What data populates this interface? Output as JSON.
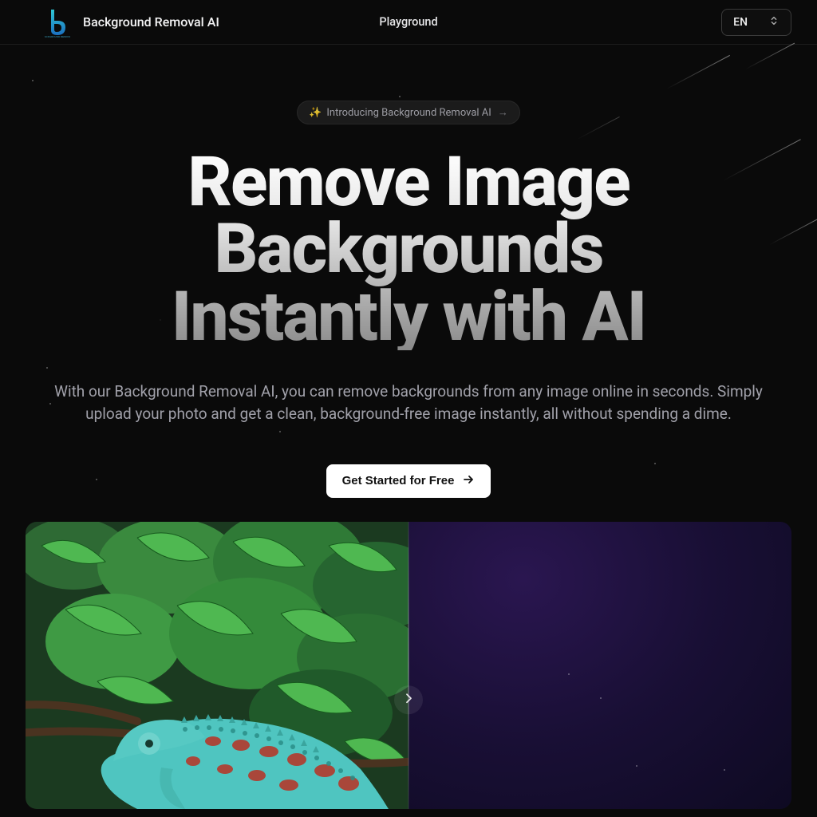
{
  "header": {
    "brand": "Background Removal AI",
    "nav": {
      "playground": "Playground"
    },
    "language": {
      "selected": "EN"
    }
  },
  "hero": {
    "announcement": "Introducing Background Removal AI",
    "title_line1": "Remove Image",
    "title_line2": "Backgrounds",
    "title_line3": "Instantly with AI",
    "subtitle": "With our Background Removal AI, you can remove backgrounds from any image online in seconds. Simply upload your photo and get a clean, background-free image instantly, all without spending a dime.",
    "cta": "Get Started for Free"
  },
  "colors": {
    "accent_cyan": "#2fc7d6",
    "accent_blue": "#1b6fbf"
  }
}
